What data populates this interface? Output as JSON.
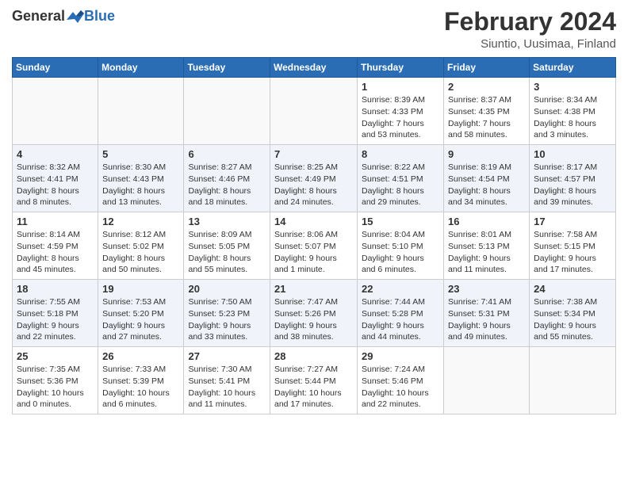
{
  "header": {
    "logo_general": "General",
    "logo_blue": "Blue",
    "title": "February 2024",
    "location": "Siuntio, Uusimaa, Finland"
  },
  "weekdays": [
    "Sunday",
    "Monday",
    "Tuesday",
    "Wednesday",
    "Thursday",
    "Friday",
    "Saturday"
  ],
  "weeks": [
    [
      {
        "day": "",
        "info": ""
      },
      {
        "day": "",
        "info": ""
      },
      {
        "day": "",
        "info": ""
      },
      {
        "day": "",
        "info": ""
      },
      {
        "day": "1",
        "info": "Sunrise: 8:39 AM\nSunset: 4:33 PM\nDaylight: 7 hours\nand 53 minutes."
      },
      {
        "day": "2",
        "info": "Sunrise: 8:37 AM\nSunset: 4:35 PM\nDaylight: 7 hours\nand 58 minutes."
      },
      {
        "day": "3",
        "info": "Sunrise: 8:34 AM\nSunset: 4:38 PM\nDaylight: 8 hours\nand 3 minutes."
      }
    ],
    [
      {
        "day": "4",
        "info": "Sunrise: 8:32 AM\nSunset: 4:41 PM\nDaylight: 8 hours\nand 8 minutes."
      },
      {
        "day": "5",
        "info": "Sunrise: 8:30 AM\nSunset: 4:43 PM\nDaylight: 8 hours\nand 13 minutes."
      },
      {
        "day": "6",
        "info": "Sunrise: 8:27 AM\nSunset: 4:46 PM\nDaylight: 8 hours\nand 18 minutes."
      },
      {
        "day": "7",
        "info": "Sunrise: 8:25 AM\nSunset: 4:49 PM\nDaylight: 8 hours\nand 24 minutes."
      },
      {
        "day": "8",
        "info": "Sunrise: 8:22 AM\nSunset: 4:51 PM\nDaylight: 8 hours\nand 29 minutes."
      },
      {
        "day": "9",
        "info": "Sunrise: 8:19 AM\nSunset: 4:54 PM\nDaylight: 8 hours\nand 34 minutes."
      },
      {
        "day": "10",
        "info": "Sunrise: 8:17 AM\nSunset: 4:57 PM\nDaylight: 8 hours\nand 39 minutes."
      }
    ],
    [
      {
        "day": "11",
        "info": "Sunrise: 8:14 AM\nSunset: 4:59 PM\nDaylight: 8 hours\nand 45 minutes."
      },
      {
        "day": "12",
        "info": "Sunrise: 8:12 AM\nSunset: 5:02 PM\nDaylight: 8 hours\nand 50 minutes."
      },
      {
        "day": "13",
        "info": "Sunrise: 8:09 AM\nSunset: 5:05 PM\nDaylight: 8 hours\nand 55 minutes."
      },
      {
        "day": "14",
        "info": "Sunrise: 8:06 AM\nSunset: 5:07 PM\nDaylight: 9 hours\nand 1 minute."
      },
      {
        "day": "15",
        "info": "Sunrise: 8:04 AM\nSunset: 5:10 PM\nDaylight: 9 hours\nand 6 minutes."
      },
      {
        "day": "16",
        "info": "Sunrise: 8:01 AM\nSunset: 5:13 PM\nDaylight: 9 hours\nand 11 minutes."
      },
      {
        "day": "17",
        "info": "Sunrise: 7:58 AM\nSunset: 5:15 PM\nDaylight: 9 hours\nand 17 minutes."
      }
    ],
    [
      {
        "day": "18",
        "info": "Sunrise: 7:55 AM\nSunset: 5:18 PM\nDaylight: 9 hours\nand 22 minutes."
      },
      {
        "day": "19",
        "info": "Sunrise: 7:53 AM\nSunset: 5:20 PM\nDaylight: 9 hours\nand 27 minutes."
      },
      {
        "day": "20",
        "info": "Sunrise: 7:50 AM\nSunset: 5:23 PM\nDaylight: 9 hours\nand 33 minutes."
      },
      {
        "day": "21",
        "info": "Sunrise: 7:47 AM\nSunset: 5:26 PM\nDaylight: 9 hours\nand 38 minutes."
      },
      {
        "day": "22",
        "info": "Sunrise: 7:44 AM\nSunset: 5:28 PM\nDaylight: 9 hours\nand 44 minutes."
      },
      {
        "day": "23",
        "info": "Sunrise: 7:41 AM\nSunset: 5:31 PM\nDaylight: 9 hours\nand 49 minutes."
      },
      {
        "day": "24",
        "info": "Sunrise: 7:38 AM\nSunset: 5:34 PM\nDaylight: 9 hours\nand 55 minutes."
      }
    ],
    [
      {
        "day": "25",
        "info": "Sunrise: 7:35 AM\nSunset: 5:36 PM\nDaylight: 10 hours\nand 0 minutes."
      },
      {
        "day": "26",
        "info": "Sunrise: 7:33 AM\nSunset: 5:39 PM\nDaylight: 10 hours\nand 6 minutes."
      },
      {
        "day": "27",
        "info": "Sunrise: 7:30 AM\nSunset: 5:41 PM\nDaylight: 10 hours\nand 11 minutes."
      },
      {
        "day": "28",
        "info": "Sunrise: 7:27 AM\nSunset: 5:44 PM\nDaylight: 10 hours\nand 17 minutes."
      },
      {
        "day": "29",
        "info": "Sunrise: 7:24 AM\nSunset: 5:46 PM\nDaylight: 10 hours\nand 22 minutes."
      },
      {
        "day": "",
        "info": ""
      },
      {
        "day": "",
        "info": ""
      }
    ]
  ]
}
